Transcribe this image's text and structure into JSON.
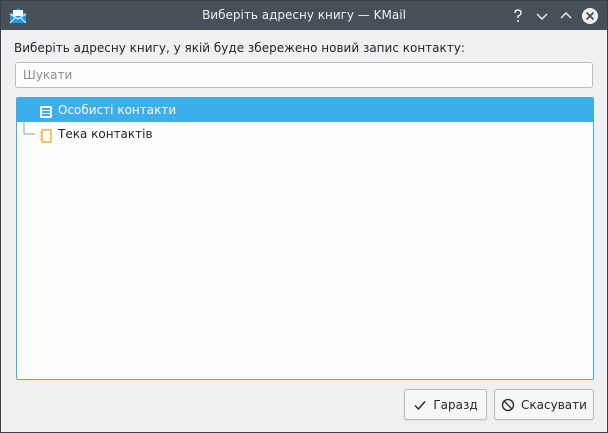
{
  "window": {
    "title": "Виберіть адресну книгу — KMail",
    "buttons": [
      "help-icon",
      "minimize-icon",
      "maximize-icon",
      "close-icon"
    ]
  },
  "dialog": {
    "prompt": "Виберіть адресну книгу, у якій буде збережено новий запис контакту:",
    "search": {
      "placeholder": "Шукати",
      "value": ""
    },
    "tree": {
      "items": [
        {
          "label": "Особисті контакти",
          "icon": "addressbook-icon",
          "selected": true
        },
        {
          "label": "Тека контактів",
          "icon": "folder-contacts-icon",
          "selected": false
        }
      ]
    },
    "buttons": {
      "ok_label": "Гаразд",
      "cancel_label": "Скасувати"
    }
  },
  "colors": {
    "titlebar": "#475057",
    "selection": "#3daee9",
    "window_bg": "#eff0f1",
    "close_button": "#eff0f1",
    "folder_icon": "#f0a30a"
  }
}
